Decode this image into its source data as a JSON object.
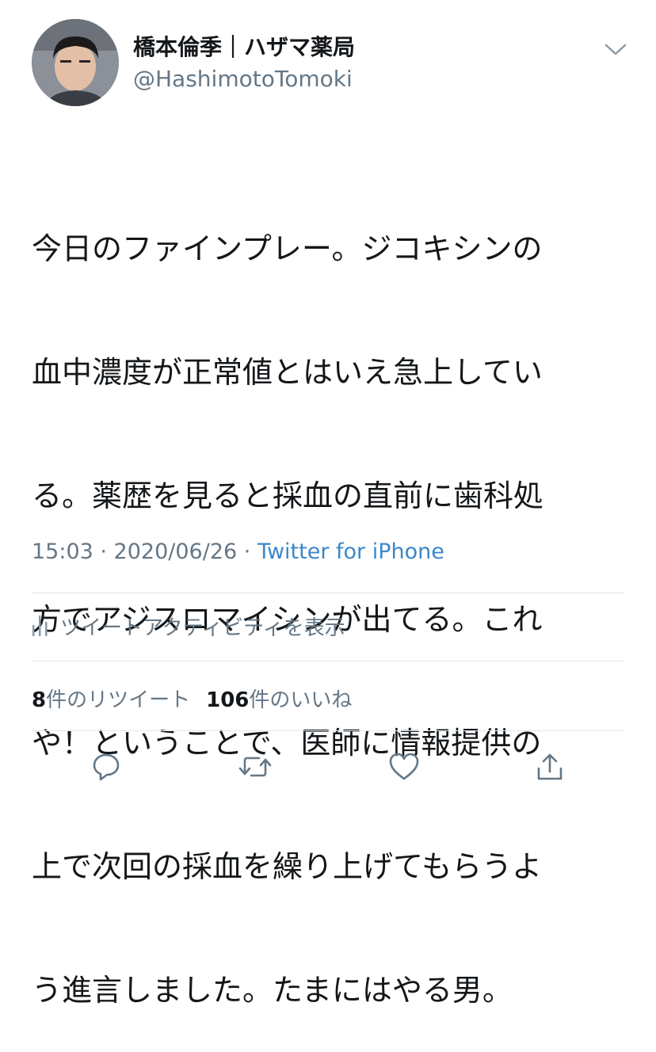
{
  "user": {
    "display_name": "橋本倫季｜ハザマ薬局",
    "handle": "@HashimotoTomoki"
  },
  "tweet": {
    "lines": [
      "今日のファインプレー。ジコキシンの",
      "血中濃度が正常値とはいえ急上してい",
      "る。薬歴を見ると採血の直前に歯科処",
      "方でアジスロマイシンが出てる。これ",
      "や！ということで、医師に情報提供の",
      "上で次回の採血を繰り上げてもらうよ",
      "う進言しました。たまにはやる男。"
    ]
  },
  "meta": {
    "time_date": "15:03 · 2020/06/26 · ",
    "source": "Twitter for iPhone"
  },
  "activity": {
    "label": "ツイートアクティビティを表示"
  },
  "stats": {
    "retweets_count": "8",
    "retweets_label": "件のリツイート",
    "likes_count": "106",
    "likes_label": "件のいいね"
  },
  "icons": {
    "chevron": "chevron-down-icon",
    "activity": "bar-chart-icon",
    "reply": "reply-icon",
    "retweet": "retweet-icon",
    "like": "heart-icon",
    "share": "share-icon"
  },
  "colors": {
    "text": "#14171a",
    "secondary": "#657786",
    "link": "#3b87c9",
    "divider": "#e1e8ed"
  }
}
